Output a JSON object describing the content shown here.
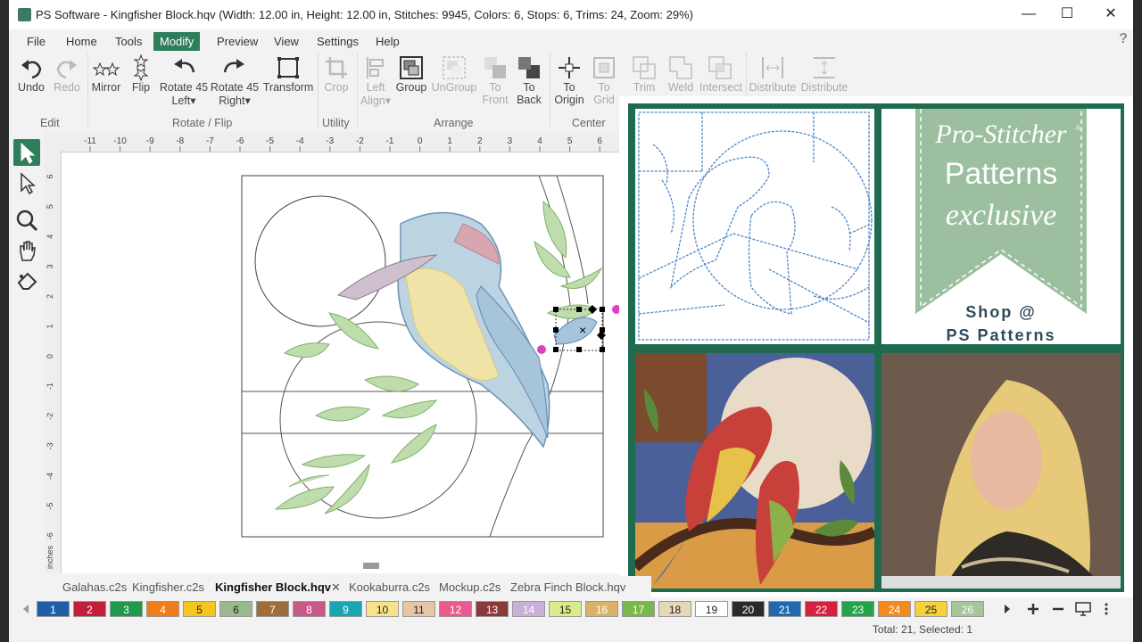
{
  "window": {
    "title": "PS Software - Kingfisher Block.hqv (Width: 12.00 in, Height: 12.00 in, Stitches: 9945, Colors: 6, Stops: 6, Trims: 24, Zoom: 29%)",
    "minimize": "—",
    "maximize": "☐",
    "close": "✕"
  },
  "menu": [
    "File",
    "Home",
    "Tools",
    "Modify",
    "Preview",
    "View",
    "Settings",
    "Help"
  ],
  "help": "?",
  "ribbon": {
    "buttons": [
      {
        "label": "Undo",
        "sub": "",
        "icon": "undo-icon"
      },
      {
        "label": "Redo",
        "sub": "",
        "icon": "redo-icon"
      },
      {
        "label": "Mirror",
        "sub": "",
        "icon": "mirror-icon"
      },
      {
        "label": "Flip",
        "sub": "",
        "icon": "flip-icon"
      },
      {
        "label": "Rotate 45",
        "sub": "Left▾",
        "icon": "rotate-left-icon"
      },
      {
        "label": "Rotate 45",
        "sub": "Right▾",
        "icon": "rotate-right-icon"
      },
      {
        "label": "Transform",
        "sub": "",
        "icon": "transform-icon"
      },
      {
        "label": "Crop",
        "sub": "",
        "icon": "crop-icon"
      },
      {
        "label": "Left",
        "sub": "Align▾",
        "icon": "align-left-icon"
      },
      {
        "label": "Group",
        "sub": "",
        "icon": "group-icon"
      },
      {
        "label": "UnGroup",
        "sub": "",
        "icon": "ungroup-icon"
      },
      {
        "label": "To",
        "sub": "Front",
        "icon": "to-front-icon"
      },
      {
        "label": "To",
        "sub": "Back",
        "icon": "to-back-icon"
      },
      {
        "label": "To",
        "sub": "Origin",
        "icon": "to-origin-icon"
      },
      {
        "label": "To",
        "sub": "Grid",
        "icon": "to-grid-icon"
      },
      {
        "label": "Trim",
        "sub": "",
        "icon": "trim-icon"
      },
      {
        "label": "Weld",
        "sub": "",
        "icon": "weld-icon"
      },
      {
        "label": "Intersect",
        "sub": "",
        "icon": "intersect-icon"
      },
      {
        "label": "Distribute",
        "sub": "",
        "icon": "distribute-horizontal-icon"
      },
      {
        "label": "Distribute",
        "sub": "",
        "icon": "distribute-vertical-icon"
      }
    ],
    "groups": [
      "Edit",
      "Rotate / Flip",
      "Utility",
      "Arrange",
      "Center"
    ]
  },
  "ruler": {
    "h": [
      "-11",
      "-10",
      "-9",
      "-8",
      "-7",
      "-6",
      "-5",
      "-4",
      "-3",
      "-2",
      "-1",
      "0",
      "1",
      "2",
      "3",
      "4",
      "5",
      "6"
    ],
    "v": [
      "6",
      "5",
      "4",
      "3",
      "2",
      "1",
      "0",
      "-1",
      "-2",
      "-3",
      "-4",
      "-5",
      "-6"
    ],
    "unit": "inches"
  },
  "ad": {
    "brand": "Pro-Stitcher",
    "reg": "®",
    "line1": "Patterns",
    "line2": "exclusive",
    "shop1": "Shop @",
    "shop2": "PS Patterns"
  },
  "tabs": [
    {
      "label": "Galahas.c2s",
      "active": false
    },
    {
      "label": "Kingfisher.c2s",
      "active": false
    },
    {
      "label": "Kingfisher Block.hqv",
      "active": true
    },
    {
      "label": "Kookaburra.c2s",
      "active": false
    },
    {
      "label": "Mockup.c2s",
      "active": false
    },
    {
      "label": "Zebra Finch Block.hqv",
      "active": false
    }
  ],
  "tab_close": "✕",
  "palette": [
    {
      "n": "1",
      "bg": "#1f5fa8",
      "fg": "#fff"
    },
    {
      "n": "2",
      "bg": "#c0203a",
      "fg": "#fff"
    },
    {
      "n": "3",
      "bg": "#1f9a4c",
      "fg": "#fff"
    },
    {
      "n": "4",
      "bg": "#f07d1c",
      "fg": "#fff"
    },
    {
      "n": "5",
      "bg": "#f6c51f",
      "fg": "#222"
    },
    {
      "n": "6",
      "bg": "#9ab88d",
      "fg": "#222"
    },
    {
      "n": "7",
      "bg": "#9e6e3a",
      "fg": "#fff"
    },
    {
      "n": "8",
      "bg": "#c85a8a",
      "fg": "#fff"
    },
    {
      "n": "9",
      "bg": "#18a6b5",
      "fg": "#fff"
    },
    {
      "n": "10",
      "bg": "#f8e28a",
      "fg": "#222"
    },
    {
      "n": "11",
      "bg": "#e5c7a8",
      "fg": "#222"
    },
    {
      "n": "12",
      "bg": "#ea5a8d",
      "fg": "#fff"
    },
    {
      "n": "13",
      "bg": "#8a3a3a",
      "fg": "#fff"
    },
    {
      "n": "14",
      "bg": "#c8b0d8",
      "fg": "#fff"
    },
    {
      "n": "15",
      "bg": "#d9ec8a",
      "fg": "#222"
    },
    {
      "n": "16",
      "bg": "#d9b36a",
      "fg": "#fff"
    },
    {
      "n": "17",
      "bg": "#79b84b",
      "fg": "#fff"
    },
    {
      "n": "18",
      "bg": "#e6d7b8",
      "fg": "#222"
    },
    {
      "n": "19",
      "bg": "#ffffff",
      "fg": "#222"
    },
    {
      "n": "20",
      "bg": "#2a2a2a",
      "fg": "#fff"
    },
    {
      "n": "21",
      "bg": "#2068b0",
      "fg": "#fff"
    },
    {
      "n": "22",
      "bg": "#d4213d",
      "fg": "#fff"
    },
    {
      "n": "23",
      "bg": "#25a34a",
      "fg": "#fff"
    },
    {
      "n": "24",
      "bg": "#f28a1e",
      "fg": "#fff"
    },
    {
      "n": "25",
      "bg": "#f5d13a",
      "fg": "#222"
    },
    {
      "n": "26",
      "bg": "#a5c59a",
      "fg": "#fff"
    }
  ],
  "status": "Total: 21, Selected: 1",
  "colors": {
    "accent": "#2e7d5b",
    "ad_frame": "#1f6b4f",
    "banner": "#9bbf9f"
  }
}
